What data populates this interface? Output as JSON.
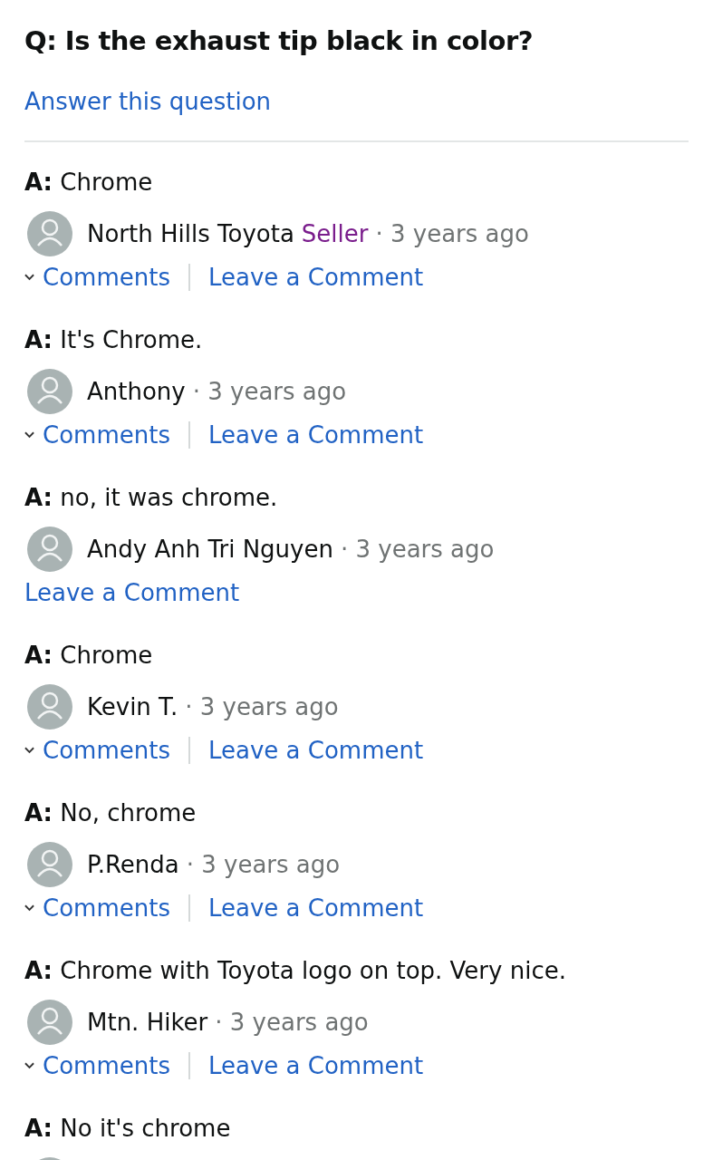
{
  "question": {
    "prefix": "Q:",
    "text": "Is the exhaust tip black in color?"
  },
  "answer_link": "Answer this question",
  "answers": [
    {
      "prefix": "A:",
      "text": "Chrome",
      "avatar": true,
      "author": "North Hills Toyota",
      "badge": "Seller",
      "time": "· 3 years ago",
      "comments": "Comments",
      "leave": "Leave a Comment"
    },
    {
      "prefix": "A:",
      "text": "It's Chrome.",
      "avatar": true,
      "author": "Anthony",
      "time": "· 3 years ago",
      "comments": "Comments",
      "leave": "Leave a Comment"
    },
    {
      "prefix": "A:",
      "text": "no, it was chrome.",
      "avatar": true,
      "author": "Andy Anh Tri Nguyen",
      "time": "· 3 years ago",
      "leave": "Leave a Comment"
    },
    {
      "prefix": "A:",
      "text": "Chrome",
      "avatar": true,
      "author": "Kevin T.",
      "time": "· 3 years ago",
      "comments": "Comments",
      "leave": "Leave a Comment"
    },
    {
      "prefix": "A:",
      "text": "No, chrome",
      "avatar": true,
      "author": "P.Renda",
      "time": "· 3 years ago",
      "comments": "Comments",
      "leave": "Leave a Comment"
    },
    {
      "prefix": "A:",
      "text": "Chrome with Toyota logo on top. Very nice.",
      "avatar": true,
      "author": "Mtn. Hiker",
      "time": "· 3 years ago",
      "comments": "Comments",
      "leave": "Leave a Comment"
    },
    {
      "prefix": "A:",
      "text": "No it's chrome",
      "avatar": true
    }
  ]
}
